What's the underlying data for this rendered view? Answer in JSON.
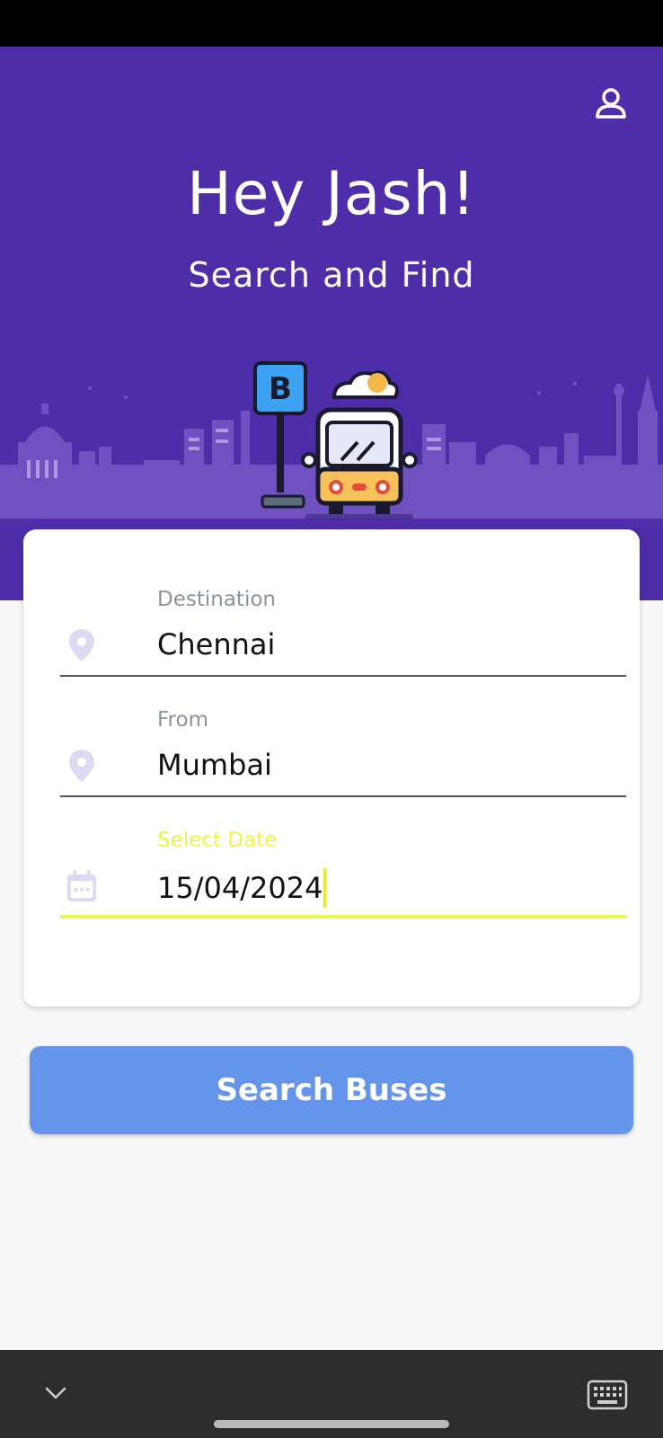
{
  "header": {
    "greeting": "Hey Jash!",
    "subtitle": "Search and Find",
    "profile_icon": "person-icon"
  },
  "illustration": {
    "bus_stop_sign": "B"
  },
  "form": {
    "destination": {
      "label": "Destination",
      "value": "Chennai",
      "icon": "location-pin-icon"
    },
    "from": {
      "label": "From",
      "value": "Mumbai",
      "icon": "location-pin-icon"
    },
    "date": {
      "label": "Select Date",
      "value": "15/04/2024",
      "icon": "calendar-icon",
      "focused": true
    }
  },
  "search_button": {
    "label": "Search Buses"
  },
  "colors": {
    "hero": "#4e2ea8",
    "accent_focus": "#eef54a",
    "button": "#6595ea",
    "icon_muted": "#ded9f2"
  },
  "nav_bar": {
    "collapse_icon": "chevron-down-icon",
    "keyboard_icon": "keyboard-icon"
  }
}
